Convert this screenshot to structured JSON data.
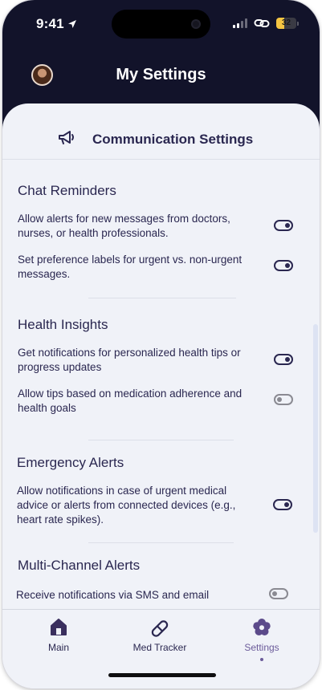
{
  "status": {
    "time": "9:41",
    "battery": "32"
  },
  "header": {
    "title": "My Settings"
  },
  "section": {
    "title": "Communication Settings"
  },
  "groups": [
    {
      "title": "Chat Reminders",
      "items": [
        {
          "text": "Allow alerts for new messages from doctors, nurses, or health professionals.",
          "enabled": true
        },
        {
          "text": "Set preference labels for urgent vs. non-urgent messages.",
          "enabled": true
        }
      ]
    },
    {
      "title": "Health Insights",
      "items": [
        {
          "text": "Get notifications for personalized health tips or progress updates",
          "enabled": true
        },
        {
          "text": "Allow tips based on medication adherence and health goals",
          "enabled": false
        }
      ]
    },
    {
      "title": "Emergency Alerts",
      "items": [
        {
          "text": "Allow notifications in case of urgent medical advice or alerts from connected devices (e.g., heart rate spikes).",
          "enabled": true
        }
      ]
    },
    {
      "title": "Multi-Channel Alerts",
      "items": [
        {
          "text": "Receive notifications via SMS and email",
          "enabled": false
        }
      ]
    }
  ],
  "tabs": [
    {
      "label": "Main",
      "icon": "home-icon"
    },
    {
      "label": "Med Tracker",
      "icon": "pill-icon"
    },
    {
      "label": "Settings",
      "icon": "flower-gear-icon",
      "active": true
    }
  ],
  "colors": {
    "header_bg": "#12132a",
    "text": "#2a2750",
    "accent": "#6b5b9a",
    "background": "#f0f2f8"
  }
}
